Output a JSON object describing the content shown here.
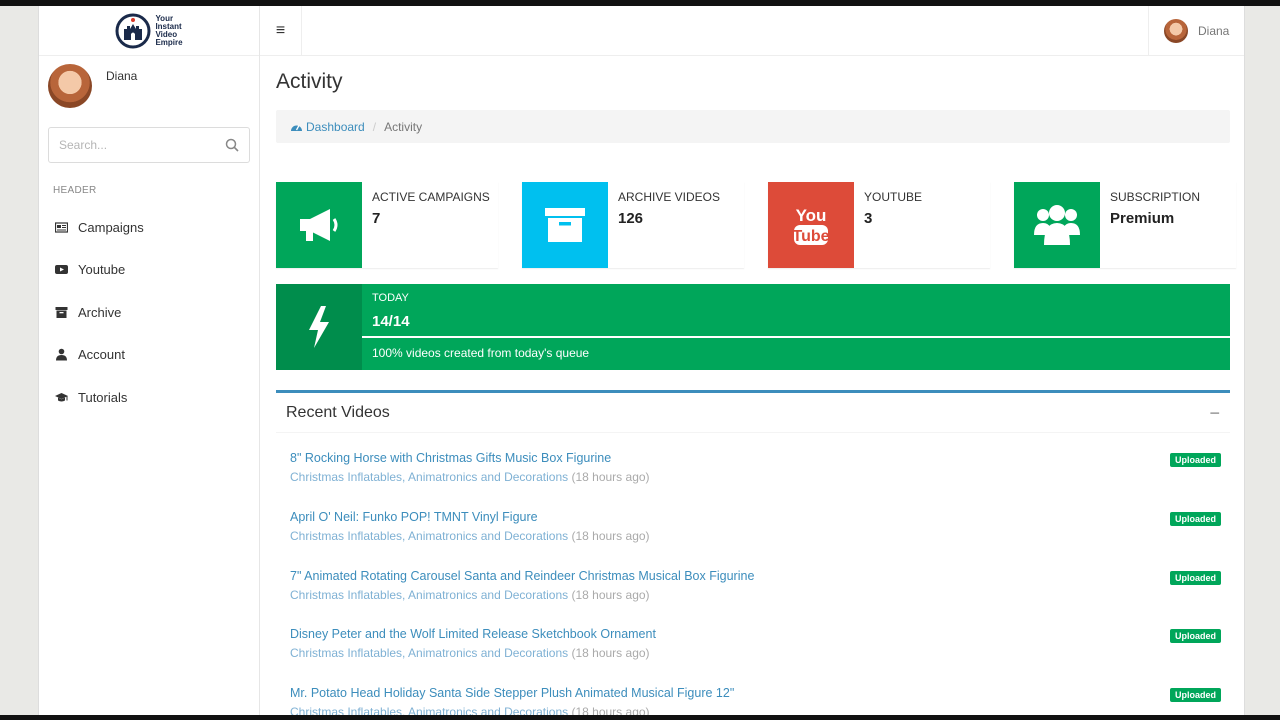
{
  "brand": {
    "logo_lines": [
      "Your",
      "Instant",
      "Video",
      "Empire"
    ]
  },
  "sidebar": {
    "user_name": "Diana",
    "search_placeholder": "Search...",
    "header": "HEADER",
    "items": [
      {
        "label": "Campaigns",
        "icon": "newspaper-icon"
      },
      {
        "label": "Youtube",
        "icon": "youtube-icon"
      },
      {
        "label": "Archive",
        "icon": "archive-icon"
      },
      {
        "label": "Account",
        "icon": "user-icon"
      },
      {
        "label": "Tutorials",
        "icon": "graduation-cap-icon"
      }
    ]
  },
  "topbar": {
    "menu_icon": "≡",
    "user_name": "Diana"
  },
  "page": {
    "title": "Activity"
  },
  "breadcrumb": {
    "home": "Dashboard",
    "current": "Activity",
    "separator": "/"
  },
  "stats": [
    {
      "label": "ACTIVE CAMPAIGNS",
      "value": "7",
      "color": "#00a65a",
      "icon": "megaphone-icon"
    },
    {
      "label": "ARCHIVE VIDEOS",
      "value": "126",
      "color": "#00c0ef",
      "icon": "archive-box-icon"
    },
    {
      "label": "YOUTUBE",
      "value": "3",
      "color": "#dd4b39",
      "icon": "youtube-logo-icon"
    },
    {
      "label": "SUBSCRIPTION",
      "value": "Premium",
      "color": "#00a65a",
      "icon": "users-icon"
    }
  ],
  "today": {
    "label": "TODAY",
    "value": "14/14",
    "progress": 1.0,
    "description": "100% videos created from today's queue"
  },
  "recent_videos": {
    "title": "Recent Videos",
    "collapse_icon": "−",
    "items": [
      {
        "title": "8\" Rocking Horse with Christmas Gifts Music Box Figurine",
        "category": "Christmas Inflatables, Animatronics and Decorations",
        "time": "(18 hours ago)",
        "status": "Uploaded"
      },
      {
        "title": "April O' Neil: Funko POP! TMNT Vinyl Figure",
        "category": "Christmas Inflatables, Animatronics and Decorations",
        "time": "(18 hours ago)",
        "status": "Uploaded"
      },
      {
        "title": "7\" Animated Rotating Carousel Santa and Reindeer Christmas Musical Box Figurine",
        "category": "Christmas Inflatables, Animatronics and Decorations",
        "time": "(18 hours ago)",
        "status": "Uploaded"
      },
      {
        "title": "Disney Peter and the Wolf Limited Release Sketchbook Ornament",
        "category": "Christmas Inflatables, Animatronics and Decorations",
        "time": "(18 hours ago)",
        "status": "Uploaded"
      },
      {
        "title": "Mr. Potato Head Holiday Santa Side Stepper Plush Animated Musical Figure 12\"",
        "category": "Christmas Inflatables, Animatronics and Decorations",
        "time": "(18 hours ago)",
        "status": "Uploaded"
      }
    ]
  }
}
